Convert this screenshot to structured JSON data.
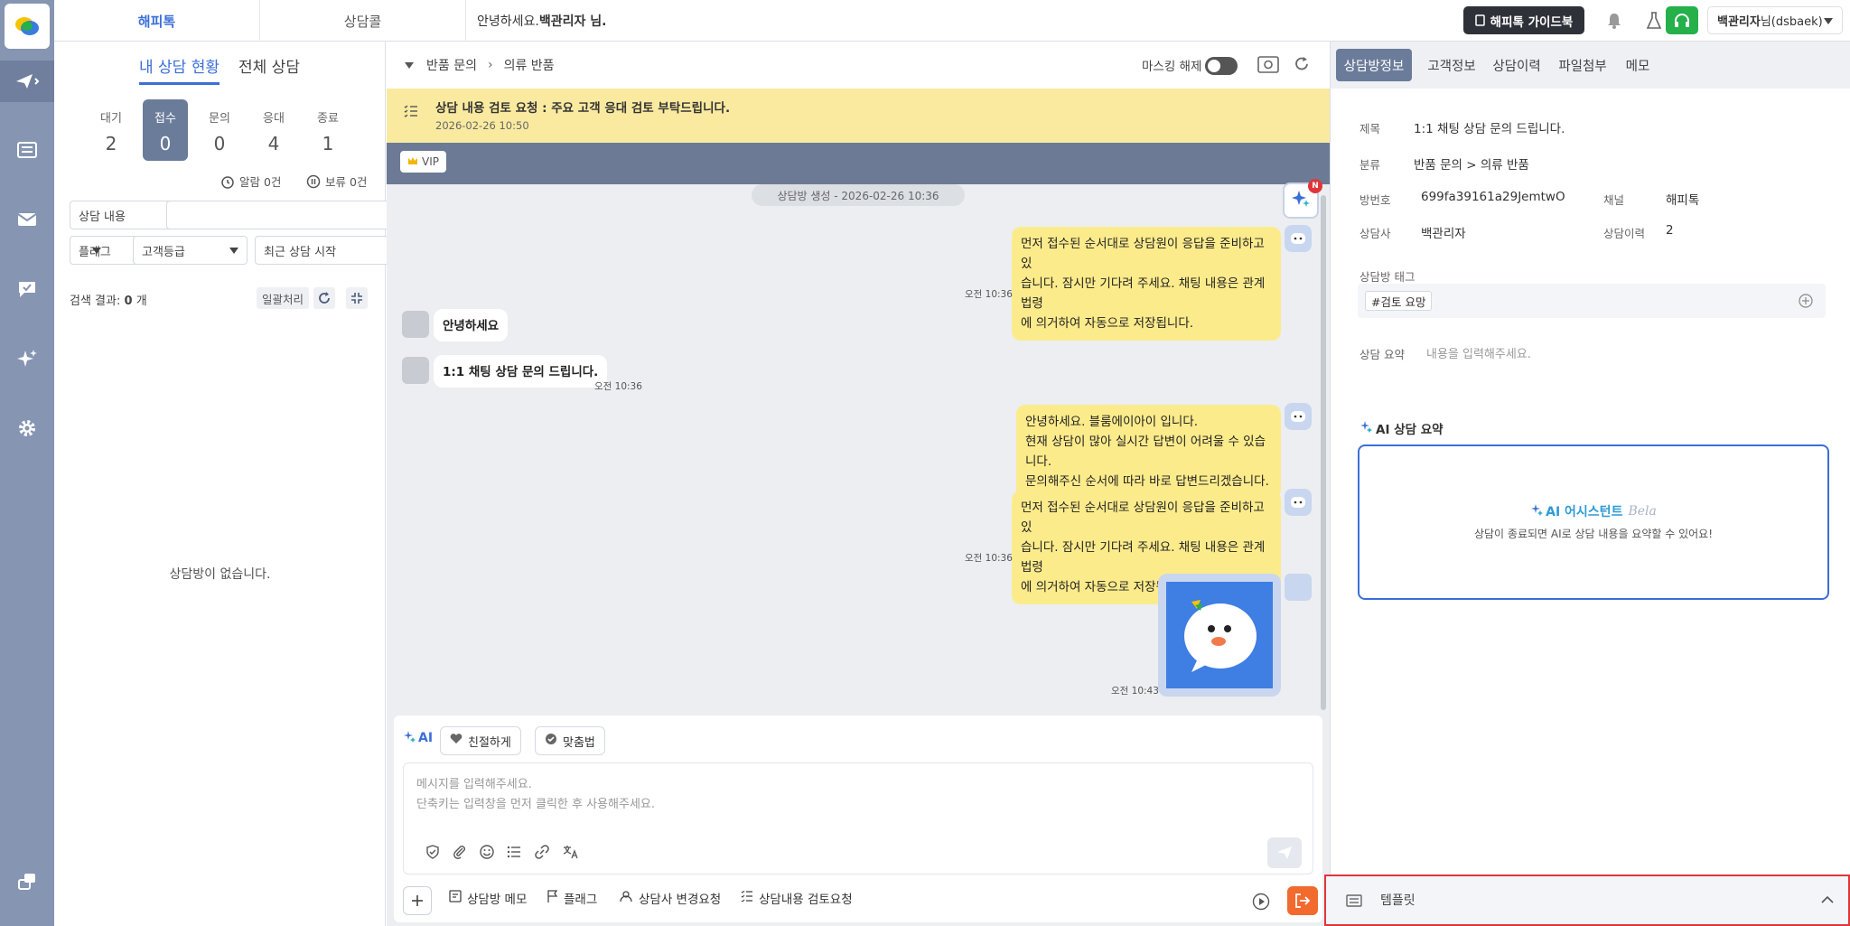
{
  "header": {
    "tabs": [
      "해피톡",
      "상담콜"
    ],
    "greeting_prefix": "안녕하세요.",
    "greeting_name": "백관리자 님.",
    "guide_button": "해피톡 가이드북",
    "user_name": "백관리자",
    "user_suffix": "님(dsbaek)"
  },
  "left_panel": {
    "tabs": [
      "내 상담 현황",
      "전체 상담"
    ],
    "stats": [
      {
        "label": "대기",
        "value": "2"
      },
      {
        "label": "접수",
        "value": "0"
      },
      {
        "label": "문의",
        "value": "0"
      },
      {
        "label": "응대",
        "value": "4"
      },
      {
        "label": "종료",
        "value": "1"
      }
    ],
    "alarm_label": "알람 0건",
    "hold_label": "보류 0건",
    "search_select": "상담 내용",
    "search_placeholder": "",
    "filter_flag": "플래그",
    "filter_grade": "고객등급",
    "filter_sort": "최근 상담 시작",
    "result_prefix": "검색 결과:",
    "result_count": "0",
    "result_suffix": "개",
    "batch_button": "일괄처리",
    "empty_text": "상담방이 없습니다."
  },
  "chat": {
    "breadcrumb": [
      "반품 문의",
      "의류 반품"
    ],
    "masking_label": "마스킹 해제",
    "notice_title": "상담 내용 검토 요청 : 주요 고객 응대 검토 부탁드립니다.",
    "notice_time": "2026-02-26 10:50",
    "vip_label": "VIP",
    "room_created": "상담방 생성 - 2026-02-26 10:36",
    "ai_badge": "N",
    "messages": [
      {
        "text1": "먼저 접수된 순서대로 상담원이 응답을 준비하고 있",
        "text2": "습니다. 잠시만 기다려 주세요. 채팅 내용은 관계법령",
        "text3": "에 의거하여 자동으로 저장됩니다.",
        "time": "오전 10:36"
      },
      {
        "text": "안녕하세요"
      },
      {
        "text": "1:1 채팅 상담 문의 드립니다.",
        "time": "오전 10:36"
      },
      {
        "text1": "안녕하세요. 블룸에이아이 입니다.",
        "text2": "현재 상담이 많아 실시간 답변이 어려울 수 있습니다.",
        "text3": "문의해주신 순서에 따라 바로 답변드리겠습니다."
      },
      {
        "text1": "먼저 접수된 순서대로 상담원이 응답을 준비하고 있",
        "text2": "습니다. 잠시만 기다려 주세요. 채팅 내용은 관계법령",
        "text3": "에 의거하여 자동으로 저장됩니다.",
        "time": "오전 10:36"
      },
      {
        "time": "오전 10:43"
      }
    ],
    "ai_label": "AI",
    "chip_friendly": "친절하게",
    "chip_spelling": "맞춤법",
    "input_placeholder_1": "메시지를 입력해주세요.",
    "input_placeholder_2": "단축키는 입력창을 먼저 클릭한 후 사용해주세요.",
    "footer": [
      "상담방 메모",
      "플래그",
      "상담사 변경요청",
      "상담내용 검토요청"
    ]
  },
  "right_panel": {
    "tabs": [
      "상담방정보",
      "고객정보",
      "상담이력",
      "파일첨부",
      "메모"
    ],
    "fields": {
      "title_label": "제목",
      "title_value": "1:1 채팅 상담 문의 드립니다.",
      "category_label": "분류",
      "category_value": "반품 문의 > 의류 반품",
      "room_label": "방번호",
      "room_value": "699fa39161a29JemtwO…",
      "channel_label": "채널",
      "channel_value": "해피톡",
      "agent_label": "상담사",
      "agent_value": "백관리자",
      "history_label": "상담이력",
      "history_value": "2"
    },
    "tag_label": "상담방 태그",
    "tag": "#검토 요망",
    "summary_label": "상담 요약",
    "summary_placeholder": "내용을 입력해주세요.",
    "ai_summary_title": "AI 상담 요약",
    "ai_assistant": "AI 어시스턴트",
    "ai_assistant_name": "Bela",
    "ai_summary_desc": "상담이 종료되면 AI로 상담 내용을 요약할 수 있어요!",
    "template_label": "템플릿"
  },
  "colors": {
    "accent": "#3b6fd8",
    "rail": "#8595b2",
    "bubble": "#fceb8b",
    "notice": "#faeaa0",
    "danger": "#e0363a",
    "green": "#25b04a"
  }
}
